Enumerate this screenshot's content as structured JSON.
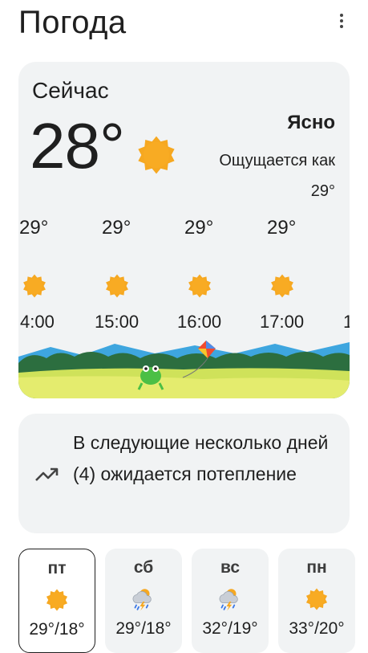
{
  "header": {
    "title": "Погода",
    "menu_icon": "more-vert-icon"
  },
  "now": {
    "label": "Сейчас",
    "temperature": "28°",
    "condition": "Ясно",
    "feels_like_label": "Ощущается как",
    "feels_like_value": "29°",
    "icon": "sun-icon",
    "hourly": [
      {
        "temp": "29°",
        "time": "4:00",
        "icon": "sun-icon"
      },
      {
        "temp": "29°",
        "time": "15:00",
        "icon": "sun-icon"
      },
      {
        "temp": "29°",
        "time": "16:00",
        "icon": "sun-icon"
      },
      {
        "temp": "29°",
        "time": "17:00",
        "icon": "sun-icon"
      },
      {
        "time": "1"
      }
    ]
  },
  "trend": {
    "text": "В следующие несколько дней (4) ожидается потепление",
    "icon": "trending-up-icon"
  },
  "days": [
    {
      "name": "пт",
      "range": "29°/18°",
      "icon": "sun-icon",
      "selected": true
    },
    {
      "name": "сб",
      "range": "29°/18°",
      "icon": "thunderstorm-icon"
    },
    {
      "name": "вс",
      "range": "32°/19°",
      "icon": "thunderstorm-icon"
    },
    {
      "name": "пн",
      "range": "33°/20°",
      "icon": "sun-icon"
    }
  ],
  "colors": {
    "card": "#f1f3f4",
    "sun": "#f6a821",
    "text": "#1f1f1f"
  }
}
